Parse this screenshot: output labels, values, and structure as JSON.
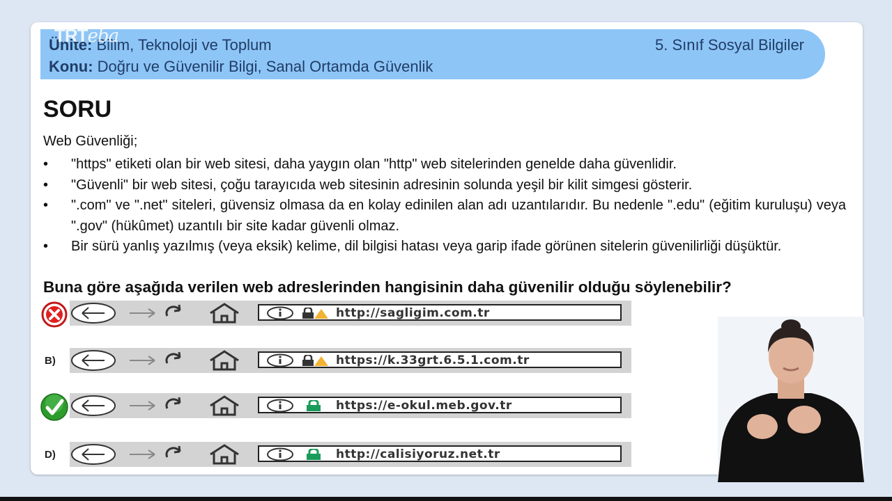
{
  "brand": {
    "trt": "TRT",
    "eba": "eba"
  },
  "header": {
    "unit_label": "Ünite:",
    "unit_value": "Bilim, Teknoloji ve Toplum",
    "topic_label": "Konu:",
    "topic_value": "Doğru ve Güvenilir Bilgi, Sanal Ortamda Güvenlik",
    "grade": "5. Sınıf Sosyal Bilgiler"
  },
  "content": {
    "title": "SORU",
    "intro": "Web Güvenliği;",
    "bullets": [
      "\"https\" etiketi olan bir web sitesi, daha yaygın olan \"http\" web sitelerinden genelde daha güvenlidir.",
      "\"Güvenli\" bir web sitesi, çoğu tarayıcıda web sitesinin adresinin solunda yeşil bir kilit simgesi gösterir.",
      "\".com\" ve \".net\" siteleri, güvensiz olmasa da en kolay edinilen alan adı uzantılarıdır. Bu nedenle \".edu\" (eğitim kuruluşu) veya \".gov\" (hükûmet) uzantılı bir site kadar güvenli olmaz.",
      "Bir sürü yanlış yazılmış (veya eksik) kelime, dil bilgisi hatası veya garip ifade görünen sitelerin güvenilirliği düşüktür."
    ],
    "bullet_symbol": "•",
    "question": "Buna göre aşağıda verilen web adreslerinden hangisinin daha güvenilir olduğu söylenebilir?"
  },
  "options": [
    {
      "letter": "",
      "mark": "wrong",
      "url": "http://sagligim.com.tr",
      "lock": "warning"
    },
    {
      "letter": "B)",
      "mark": "none",
      "url": "https://k.33grt.6.5.1.com.tr",
      "lock": "warning"
    },
    {
      "letter": "",
      "mark": "correct",
      "url": "https://e-okul.meb.gov.tr",
      "lock": "secure"
    },
    {
      "letter": "D)",
      "mark": "none",
      "url": "http://calisiyoruz.net.tr",
      "lock": "secure"
    }
  ],
  "colors": {
    "header_bg": "#8ec5f7",
    "header_text": "#1f3d66",
    "lock_secure": "#1a9b5a",
    "lock_warning": "#f2b233",
    "wrong_mark": "#e02020",
    "correct_mark": "#2c9c2c"
  }
}
